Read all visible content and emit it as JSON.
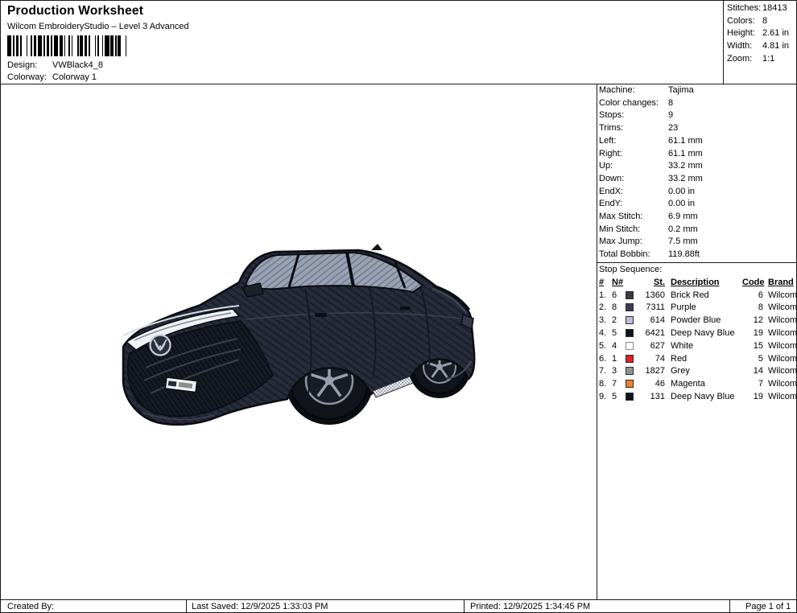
{
  "header": {
    "title": "Production Worksheet",
    "subtitle": "Wilcom EmbroideryStudio – Level 3 Advanced",
    "design_label": "Design:",
    "design_value": "VWBlack4_8",
    "colorway_label": "Colorway:",
    "colorway_value": "Colorway 1"
  },
  "summary": {
    "rows": [
      {
        "label": "Stitches:",
        "value": "18413"
      },
      {
        "label": "Colors:",
        "value": "8"
      },
      {
        "label": "Height:",
        "value": "2.61 in"
      },
      {
        "label": "Width:",
        "value": "4.81 in"
      },
      {
        "label": "Zoom:",
        "value": "1:1"
      }
    ]
  },
  "machine_info": {
    "rows": [
      {
        "label": "Machine:",
        "value": "Tajima"
      },
      {
        "label": "Color changes:",
        "value": "8"
      },
      {
        "label": "Stops:",
        "value": "9"
      },
      {
        "label": "Trims:",
        "value": "23"
      },
      {
        "label": "Left:",
        "value": "61.1 mm"
      },
      {
        "label": "Right:",
        "value": "61.1 mm"
      },
      {
        "label": "Up:",
        "value": "33.2 mm"
      },
      {
        "label": "Down:",
        "value": "33.2 mm"
      },
      {
        "label": "EndX:",
        "value": "0.00 in"
      },
      {
        "label": "EndY:",
        "value": "0.00 in"
      },
      {
        "label": "Max Stitch:",
        "value": "6.9 mm"
      },
      {
        "label": "Min Stitch:",
        "value": "0.2 mm"
      },
      {
        "label": "Max Jump:",
        "value": "7.5 mm"
      },
      {
        "label": "Total Bobbin:",
        "value": "119.88ft"
      }
    ]
  },
  "stop_sequence": {
    "title": "Stop Sequence:",
    "columns": [
      "#",
      "N#",
      "St.",
      "Description",
      "Code",
      "Brand"
    ],
    "rows": [
      {
        "num": "1.",
        "needle": "6",
        "swatch": "#3c3844",
        "stitches": "1360",
        "description": "Brick Red",
        "code": "6",
        "brand": "Wilcom"
      },
      {
        "num": "2.",
        "needle": "8",
        "swatch": "#3f3a56",
        "stitches": "7311",
        "description": "Purple",
        "code": "8",
        "brand": "Wilcom"
      },
      {
        "num": "3.",
        "needle": "2",
        "swatch": "#b9bedc",
        "stitches": "614",
        "description": "Powder Blue",
        "code": "12",
        "brand": "Wilcom"
      },
      {
        "num": "4.",
        "needle": "5",
        "swatch": "#10131d",
        "stitches": "6421",
        "description": "Deep Navy Blue",
        "code": "19",
        "brand": "Wilcom"
      },
      {
        "num": "5.",
        "needle": "4",
        "swatch": "#ffffff",
        "stitches": "627",
        "description": "White",
        "code": "15",
        "brand": "Wilcom"
      },
      {
        "num": "6.",
        "needle": "1",
        "swatch": "#e01f26",
        "stitches": "74",
        "description": "Red",
        "code": "5",
        "brand": "Wilcom"
      },
      {
        "num": "7.",
        "needle": "3",
        "swatch": "#909398",
        "stitches": "1827",
        "description": "Grey",
        "code": "14",
        "brand": "Wilcom"
      },
      {
        "num": "8.",
        "needle": "7",
        "swatch": "#f08030",
        "stitches": "46",
        "description": "Magenta",
        "code": "7",
        "brand": "Wilcom"
      },
      {
        "num": "9.",
        "needle": "5",
        "swatch": "#10131d",
        "stitches": "131",
        "description": "Deep Navy Blue",
        "code": "19",
        "brand": "Wilcom"
      }
    ]
  },
  "footer": {
    "created_by": "Created By:",
    "last_saved": "Last Saved: 12/9/2025 1:33:03 PM",
    "printed": "Printed: 12/9/2025 1:34:45 PM",
    "page": "Page 1 of 1"
  },
  "design_colors": {
    "body": "#272d3b",
    "glass": "#9aa3b4",
    "accent_red": "#c8322b",
    "sill_checker": "#eceef1"
  }
}
